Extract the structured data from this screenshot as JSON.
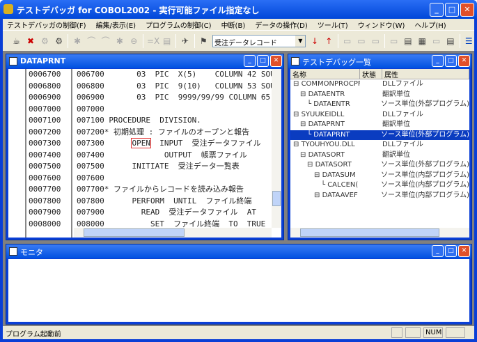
{
  "app": {
    "title": "テストデバッガ for COBOL2002 - 実行可能ファイル指定なし"
  },
  "menu": [
    "テストデバッガの制御(F)",
    "編集/表示(E)",
    "プログラムの制御(C)",
    "中断(B)",
    "データの操作(D)",
    "ツール(T)",
    "ウィンドウ(W)",
    "ヘルプ(H)"
  ],
  "toolbar": {
    "combo_value": "受注データレコード"
  },
  "code_window": {
    "title": "DATAPRNT",
    "highlighted_word": "OPEN",
    "lines": [
      {
        "num": "0006700",
        "src": "006700       03  PIC  X(5)    COLUMN 42 SOUR"
      },
      {
        "num": "0006800",
        "src": "006800       03  PIC  9(10)   COLUMN 53 SOUR"
      },
      {
        "num": "0006900",
        "src": "006900       03  PIC  9999/99/99 COLUMN 65"
      },
      {
        "num": "0007000",
        "src": "007000"
      },
      {
        "num": "0007100",
        "src": "007100 PROCEDURE  DIVISION."
      },
      {
        "num": "0007200",
        "src": "007200* 初期処理 : ファイルのオープンと報告"
      },
      {
        "num": "0007300",
        "pre": "007300      ",
        "src": "  INPUT  受注データファイル"
      },
      {
        "num": "0007400",
        "src": "007400             OUTPUT  帳票ファイル"
      },
      {
        "num": "0007500",
        "src": "007500      INITIATE  受注データ一覧表"
      },
      {
        "num": "0007600",
        "src": "007600"
      },
      {
        "num": "0007700",
        "src": "007700* ファイルからレコードを読み込み報告"
      },
      {
        "num": "0007800",
        "src": "007800      PERFORM  UNTIL  ファイル終端"
      },
      {
        "num": "0007900",
        "src": "007900        READ  受注データファイル  AT"
      },
      {
        "num": "0008000",
        "src": "008000          SET  ファイル終端  TO  TRUE"
      }
    ]
  },
  "tree_window": {
    "title": "テストデバッグ一覧",
    "columns": [
      "名称",
      "状態",
      "属性"
    ],
    "rows": [
      {
        "indent": 0,
        "name": "COMMONPROCPF",
        "attr": "DLLファイル"
      },
      {
        "indent": 1,
        "name": "DATAENTR",
        "attr": "翻訳単位"
      },
      {
        "indent": 2,
        "name": "DATAENTR",
        "attr": "ソース単位(外部プログラム)"
      },
      {
        "indent": 0,
        "name": "SYUUKEIDLL",
        "attr": "DLLファイル"
      },
      {
        "indent": 1,
        "name": "DATAPRNT",
        "attr": "翻訳単位"
      },
      {
        "indent": 2,
        "name": "DATAPRNT",
        "attr": "ソース単位(外部プログラム)",
        "selected": true
      },
      {
        "indent": 0,
        "name": "TYOUHYOU.DLL",
        "attr": "DLLファイル"
      },
      {
        "indent": 1,
        "name": "DATASORT",
        "attr": "翻訳単位"
      },
      {
        "indent": 2,
        "name": "DATASORT",
        "attr": "ソース単位(外部プログラム)"
      },
      {
        "indent": 3,
        "name": "DATASUM",
        "attr": "ソース単位(内部プログラム)"
      },
      {
        "indent": 4,
        "name": "CALCEN(",
        "attr": "ソース単位(内部プログラム)"
      },
      {
        "indent": 3,
        "name": "DATAAVEF",
        "attr": "ソース単位(内部プログラム)"
      }
    ]
  },
  "monitor_window": {
    "title": "モニタ"
  },
  "status": {
    "text": "プログラム起動前",
    "num": "NUM"
  }
}
